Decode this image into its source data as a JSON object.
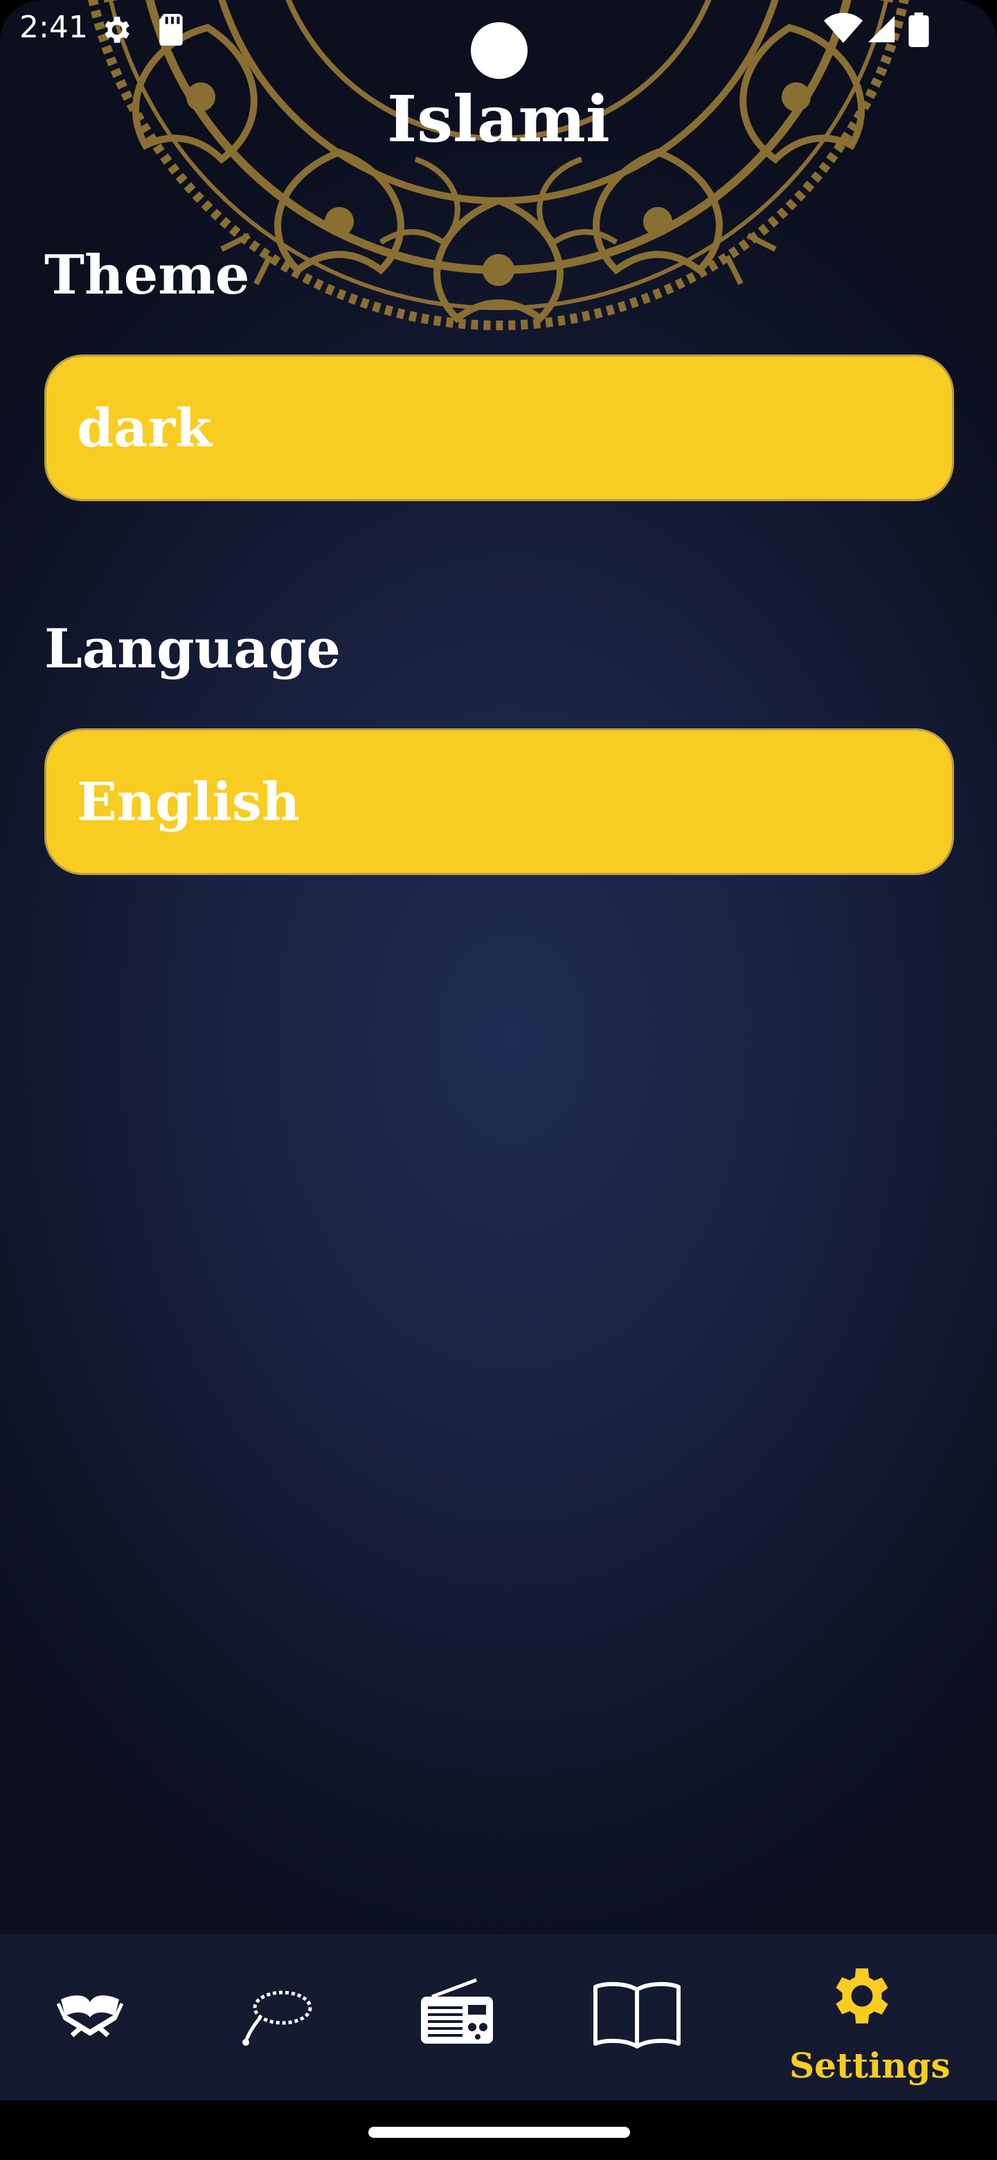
{
  "status_bar": {
    "time": "2:41",
    "icons": [
      "gear-icon",
      "sd-card-icon",
      "wifi-icon",
      "signal-icon",
      "battery-icon"
    ]
  },
  "app": {
    "title": "Islami"
  },
  "settings": {
    "theme_label": "Theme",
    "theme_value": "dark",
    "language_label": "Language",
    "language_value": "English"
  },
  "bottom_nav": {
    "items": [
      {
        "icon": "quran-icon",
        "label": "",
        "selected": false
      },
      {
        "icon": "tasbeh-icon",
        "label": "",
        "selected": false
      },
      {
        "icon": "radio-icon",
        "label": "",
        "selected": false
      },
      {
        "icon": "book-icon",
        "label": "",
        "selected": false
      },
      {
        "icon": "settings-gear-icon",
        "label": "Settings",
        "selected": true
      }
    ]
  },
  "colors": {
    "accent": "#f9cc22",
    "background_dark": "#141a30",
    "mandala_gold": "#8a6f33"
  }
}
